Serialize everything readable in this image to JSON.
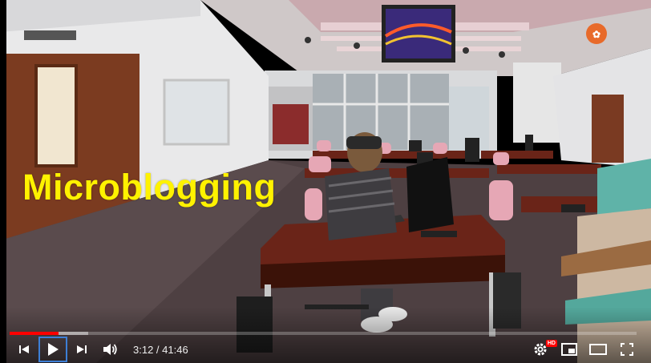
{
  "video": {
    "caption": "Microblogging",
    "time_current": "3:12",
    "time_separator": " / ",
    "time_total": "41:46",
    "progress_played_fraction": 0.078,
    "progress_buffered_fraction": 0.125,
    "quality_badge": "HD"
  },
  "colors": {
    "progress_played": "#ff0000",
    "caption": "#fff200",
    "play_focus_outline": "#3d7fd6"
  },
  "controls": {
    "icons": [
      "previous-icon",
      "play-icon",
      "next-icon",
      "volume-icon",
      "settings-icon",
      "miniplayer-icon",
      "theater-icon",
      "fullscreen-icon"
    ]
  }
}
